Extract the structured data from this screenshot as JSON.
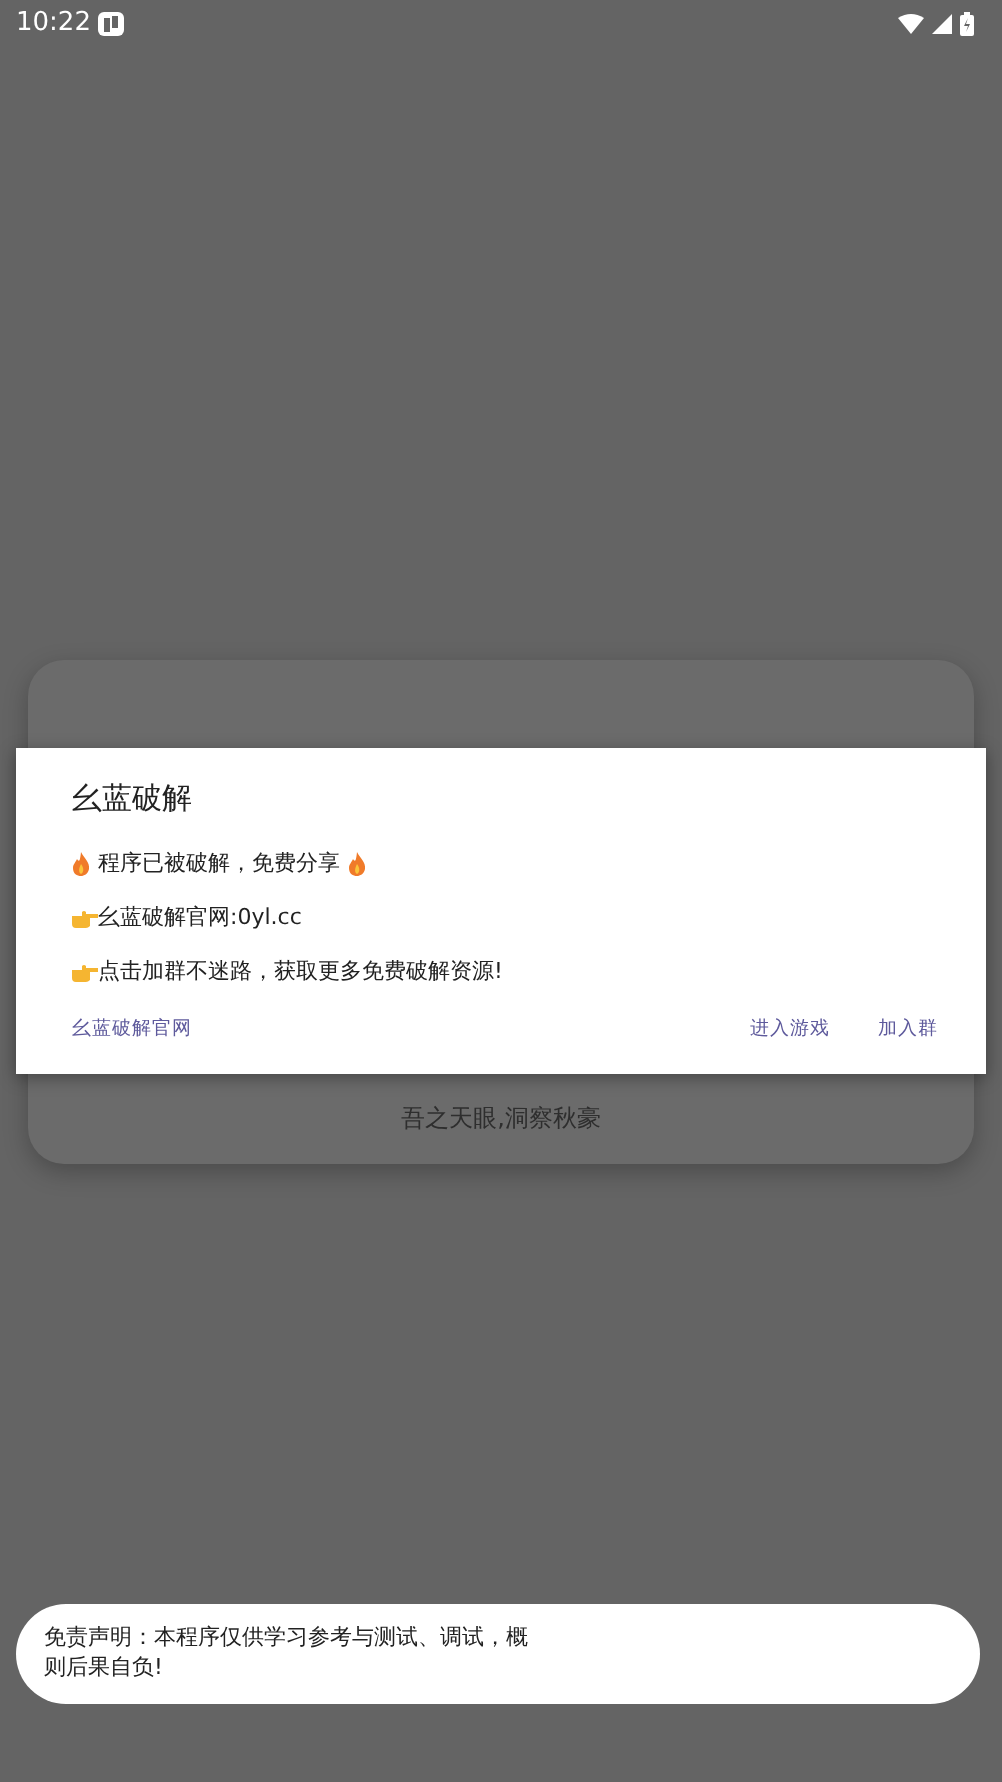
{
  "status_bar": {
    "time": "10:22"
  },
  "card": {
    "subtitle": "吾之天眼,洞察秋豪"
  },
  "dialog": {
    "title": "幺蓝破解",
    "lines": [
      {
        "kind": "fire",
        "text": "程序已被破解，免费分享"
      },
      {
        "kind": "point",
        "text": "幺蓝破解官网:0yl.cc"
      },
      {
        "kind": "point",
        "text": "点击加群不迷路，获取更多免费破解资源!"
      }
    ],
    "left_button": "幺蓝破解官网",
    "right_buttons": [
      "进入游戏",
      "加入群"
    ]
  },
  "toast": {
    "lines": [
      "免责声明：本程序仅供学习参考与测试、调试，概",
      "则后果自负!"
    ]
  }
}
